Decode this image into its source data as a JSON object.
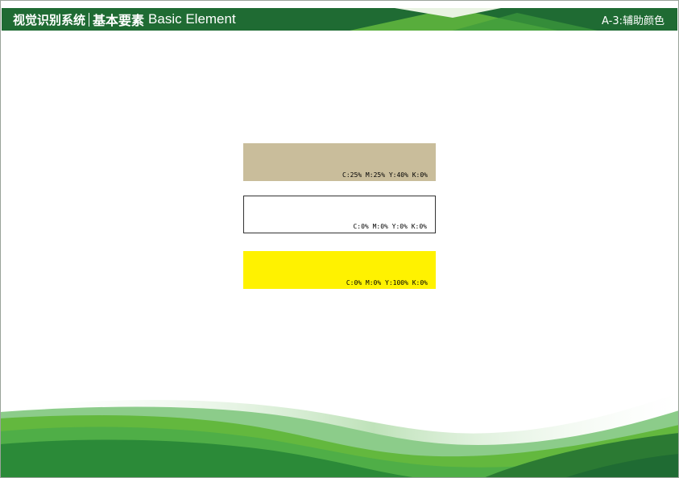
{
  "header": {
    "title_cn": "视觉识别系统",
    "subtitle_cn": "基本要素",
    "subtitle_en": "Basic Element",
    "section_code": "A-3:辅助颜色"
  },
  "swatches": [
    {
      "label": "C:25% M:25% Y:40% K:0%",
      "color": "#c9bd9b"
    },
    {
      "label": "C:0% M:0% Y:0% K:0%",
      "color": "#ffffff"
    },
    {
      "label": "C:0% M:0% Y:100% K:0%",
      "color": "#fff200"
    }
  ],
  "colors": {
    "header_green": "#1f6b33",
    "accent_light_green": "#63b83e",
    "wave_dark_green": "#2b8a38",
    "wave_mid_green": "#4fae47",
    "wave_pale_green": "#8ccc8a"
  }
}
